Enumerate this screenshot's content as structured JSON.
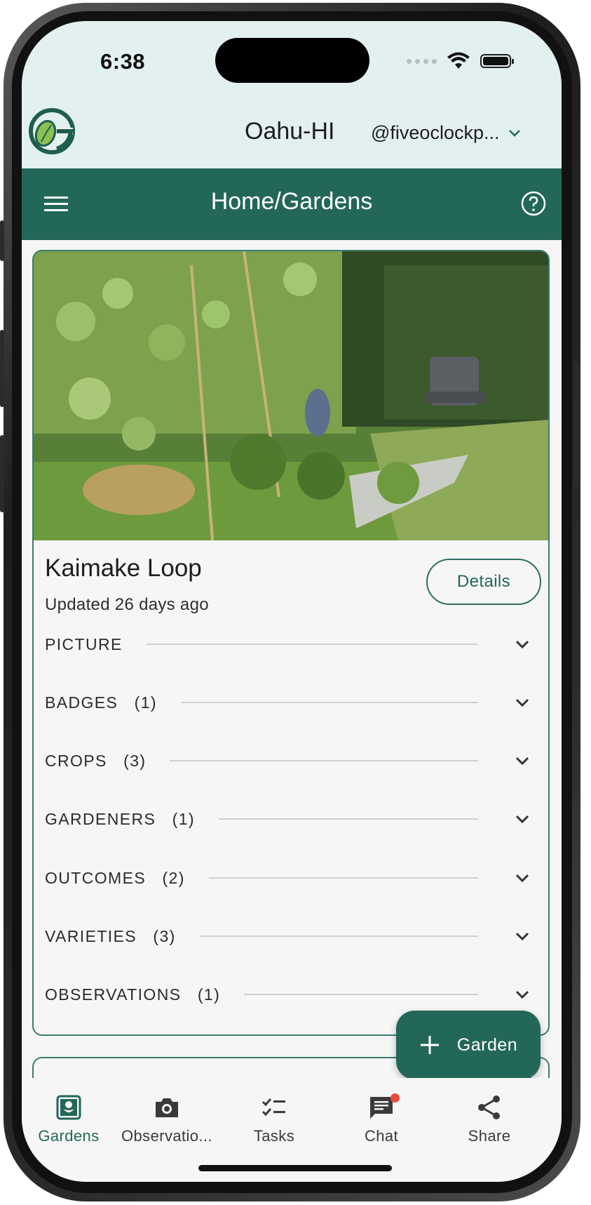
{
  "status_bar": {
    "time": "6:38"
  },
  "header": {
    "region": "Oahu-HI",
    "user": "@fiveoclockp...",
    "logo_icon": "garden-logo-icon"
  },
  "app_bar": {
    "title": "Home/Gardens",
    "menu_icon": "menu-icon",
    "help_icon": "help-icon",
    "color": "#236759"
  },
  "garden_card": {
    "title": "Kaimake Loop",
    "updated": "Updated 26 days ago",
    "details_label": "Details",
    "sections": [
      {
        "label": "PICTURE"
      },
      {
        "label": "BADGES   (1)"
      },
      {
        "label": "CROPS   (3)"
      },
      {
        "label": "GARDENERS   (1)"
      },
      {
        "label": "OUTCOMES   (2)"
      },
      {
        "label": "VARIETIES   (3)"
      },
      {
        "label": "OBSERVATIONS   (1)"
      }
    ]
  },
  "fab": {
    "label": "Garden",
    "icon": "plus-icon"
  },
  "bottom_nav": {
    "items": [
      {
        "label": "Gardens",
        "icon": "garden-icon",
        "active": true
      },
      {
        "label": "Observatio...",
        "icon": "camera-icon"
      },
      {
        "label": "Tasks",
        "icon": "tasks-icon"
      },
      {
        "label": "Chat",
        "icon": "chat-icon",
        "has_notification": true
      },
      {
        "label": "Share",
        "icon": "share-icon"
      }
    ]
  }
}
